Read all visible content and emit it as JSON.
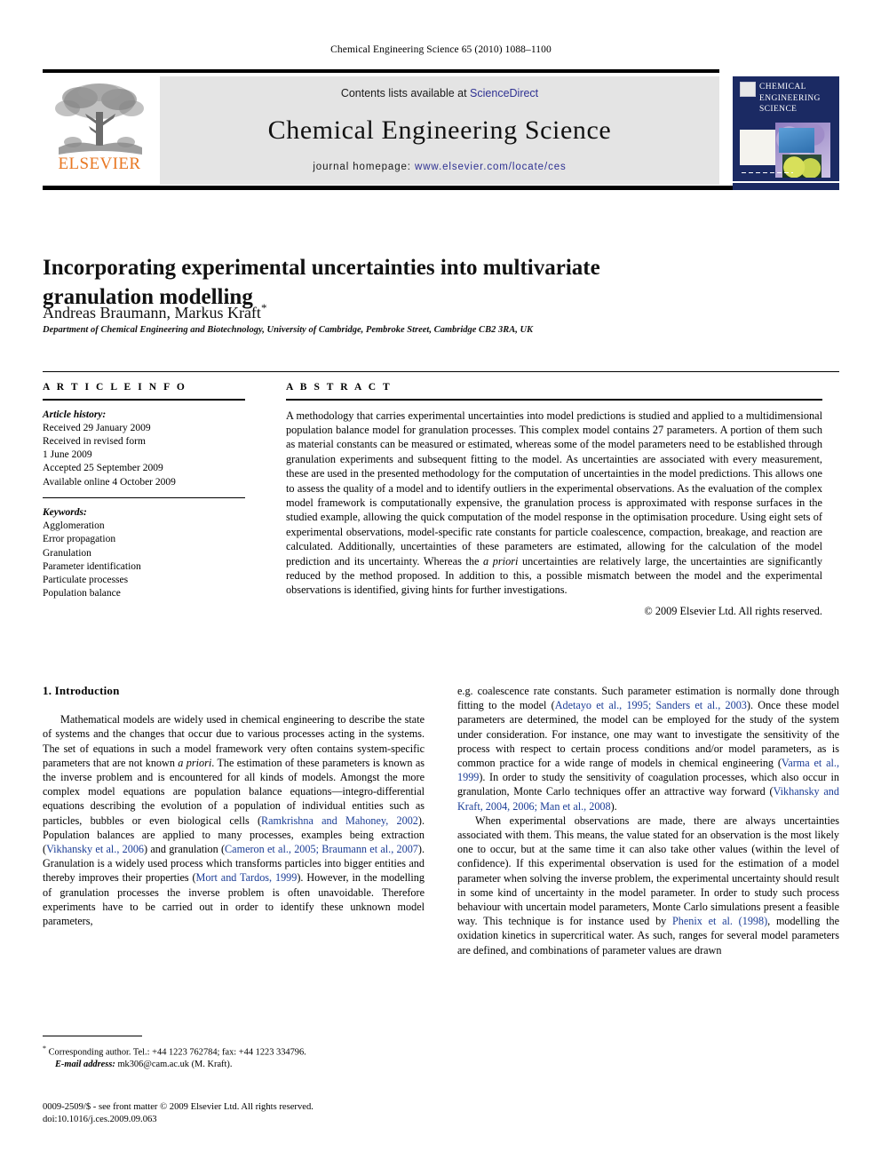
{
  "running_head": "Chemical Engineering Science 65 (2010) 1088–1100",
  "masthead": {
    "contents_prefix": "Contents lists available at ",
    "sciencedirect": "ScienceDirect",
    "journal_name": "Chemical Engineering Science",
    "homepage_prefix": "journal homepage: ",
    "homepage_url": "www.elsevier.com/locate/ces",
    "publisher": "ELSEVIER",
    "publisher_color": "#e87722",
    "link_color": "#2e3192"
  },
  "cover": {
    "line1": "CHEMICAL",
    "line2": "ENGINEERING",
    "line3": "SCIENCE",
    "background_color": "#1b2a63"
  },
  "article": {
    "title": "Incorporating experimental uncertainties into multivariate granulation modelling",
    "authors": "Andreas Braumann, Markus Kraft",
    "corresponding_marker": "*",
    "affiliation": "Department of Chemical Engineering and Biotechnology, University of Cambridge, Pembroke Street, Cambridge CB2 3RA, UK"
  },
  "info": {
    "heading": "A R T I C L E    I N F O",
    "history_label": "Article history:",
    "history": [
      "Received 29 January 2009",
      "Received in revised form",
      "1 June 2009",
      "Accepted 25 September 2009",
      "Available online 4 October 2009"
    ],
    "keywords_label": "Keywords:",
    "keywords": [
      "Agglomeration",
      "Error propagation",
      "Granulation",
      "Parameter identification",
      "Particulate processes",
      "Population balance"
    ]
  },
  "abstract": {
    "heading": "A B S T R A C T",
    "part1": "A methodology that carries experimental uncertainties into model predictions is studied and applied to a multidimensional population balance model for granulation processes. This complex model contains 27 parameters. A portion of them such as material constants can be measured or estimated, whereas some of the model parameters need to be established through granulation experiments and subsequent fitting to the model. As uncertainties are associated with every measurement, these are used in the presented methodology for the computation of uncertainties in the model predictions. This allows one to assess the quality of a model and to identify outliers in the experimental observations. As the evaluation of the complex model framework is computationally expensive, the granulation process is approximated with response surfaces in the studied example, allowing the quick computation of the model response in the optimisation procedure. Using eight sets of experimental observations, model-specific rate constants for particle coalescence, compaction, breakage, and reaction are calculated. Additionally, uncertainties of these parameters are estimated, allowing for the calculation of the model prediction and its uncertainty. Whereas the ",
    "italic1": "a priori",
    "part2": " uncertainties are relatively large, the uncertainties are significantly reduced by the method proposed. In addition to this, a possible mismatch between the model and the experimental observations is identified, giving hints for further investigations.",
    "copyright": "© 2009 Elsevier Ltd. All rights reserved."
  },
  "introduction": {
    "section_number_title": "1.  Introduction",
    "left_p1_a": "Mathematical models are widely used in chemical engineering to describe the state of systems and the changes that occur due to various processes acting in the systems. The set of equations in such a model framework very often contains system-specific parameters that are not known ",
    "left_p1_italic": "a priori",
    "left_p1_b": ". The estimation of these parameters is known as the inverse problem and is encountered for all kinds of models. Amongst the more complex model equations are population balance equations—integro-differential equations describing the evolution of a population of individual entities such as particles, bubbles or even biological cells (",
    "cite_ramkrishna": "Ramkrishna and Mahoney, 2002",
    "left_p1_c": "). Population balances are applied to many processes, examples being extraction (",
    "cite_vikhansky2006": "Vikhansky et al., 2006",
    "left_p1_d": ") and granulation (",
    "cite_cameron_braumann": "Cameron et al., 2005; Braumann et al., 2007",
    "left_p1_e": "). Granulation is a widely used process which transforms particles into bigger entities and thereby improves their properties (",
    "cite_mort": "Mort and Tardos, 1999",
    "left_p1_f": "). However, in the modelling of granulation processes the inverse problem is often unavoidable. Therefore experiments have to be carried out in order to identify these unknown model parameters,",
    "right_p1_a": "e.g. coalescence rate constants. Such parameter estimation is normally done through fitting to the model (",
    "cite_adetayo_sanders": "Adetayo et al., 1995; Sanders et al., 2003",
    "right_p1_b": "). Once these model parameters are determined, the model can be employed for the study of the system under consideration. For instance, one may want to investigate the sensitivity of the process with respect to certain process conditions and/or model parameters, as is common practice for a wide range of models in chemical engineering (",
    "cite_varma": "Varma et al., 1999",
    "right_p1_c": "). In order to study the sensitivity of coagulation processes, which also occur in granulation, Monte Carlo techniques offer an attractive way forward (",
    "cite_vikhansky_man": "Vikhansky and Kraft, 2004, 2006; Man et al., 2008",
    "right_p1_d": ").",
    "right_p2_a": "When experimental observations are made, there are always uncertainties associated with them. This means, the value stated for an observation is the most likely one to occur, but at the same time it can also take other values (within the level of confidence). If this experimental observation is used for the estimation of a model parameter when solving the inverse problem, the experimental uncertainty should result in some kind of uncertainty in the model parameter. In order to study such process behaviour with uncertain model parameters, Monte Carlo simulations present a feasible way. This technique is for instance used by ",
    "cite_phenix": "Phenix et al. (1998)",
    "right_p2_b": ", modelling the oxidation kinetics in supercritical water. As such, ranges for several model parameters are defined, and combinations of parameter values are drawn",
    "citation_color": "#1b3d96"
  },
  "footnote": {
    "marker": "*",
    "text": " Corresponding author. Tel.: +44 1223 762784; fax: +44 1223 334796.",
    "email_label": "E-mail address:",
    "email": " mk306@cam.ac.uk (M. Kraft)."
  },
  "footer": {
    "line1": "0009-2509/$ - see front matter © 2009 Elsevier Ltd. All rights reserved.",
    "line2": "doi:10.1016/j.ces.2009.09.063"
  }
}
